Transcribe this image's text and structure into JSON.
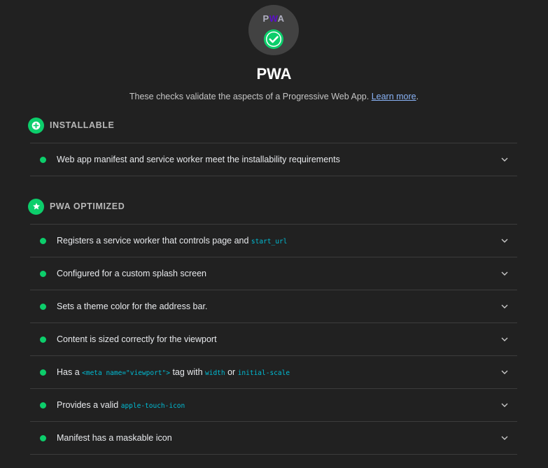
{
  "gauge": {
    "logo": {
      "p": "P",
      "w": "W",
      "a": "A"
    },
    "status_icon": "check-circle-icon"
  },
  "category": {
    "title": "PWA",
    "description": "These checks validate the aspects of a Progressive Web App.",
    "learn_more": "Learn more",
    "trailing": "."
  },
  "colors": {
    "pass": "#0cce6b",
    "background": "#212121",
    "code": "#00bcd4",
    "link": "#8ab4f8"
  },
  "groups": {
    "installable": {
      "title": "INSTALLABLE",
      "icon": "plus-circle-icon",
      "audits": [
        {
          "text": "Web app manifest and service worker meet the installability requirements"
        }
      ]
    },
    "optimized": {
      "title": "PWA OPTIMIZED",
      "icon": "star-icon",
      "audits": [
        {
          "parts": [
            "Registers a service worker that controls page and ",
            "start_url"
          ]
        },
        {
          "text": "Configured for a custom splash screen"
        },
        {
          "text": "Sets a theme color for the address bar."
        },
        {
          "text": "Content is sized correctly for the viewport"
        },
        {
          "parts": [
            "Has a ",
            "<meta name=\"viewport\">",
            " tag with ",
            "width",
            " or ",
            "initial-scale"
          ]
        },
        {
          "parts": [
            "Provides a valid ",
            "apple-touch-icon"
          ]
        },
        {
          "text": "Manifest has a maskable icon"
        }
      ]
    }
  }
}
